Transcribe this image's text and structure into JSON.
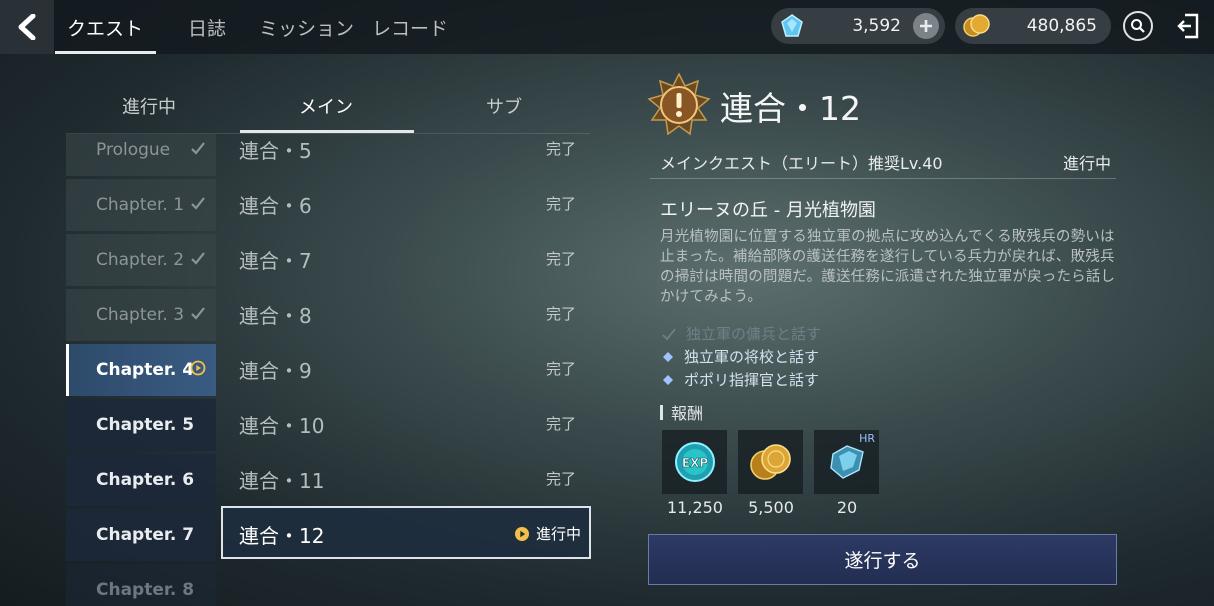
{
  "top_tabs": [
    "クエスト",
    "日誌",
    "ミッション",
    "レコード"
  ],
  "currency": {
    "gems": "3,592",
    "gold": "480,865"
  },
  "sub_tabs": [
    "進行中",
    "メイン",
    "サブ"
  ],
  "chapters": [
    {
      "label": "Prologue",
      "state": "done"
    },
    {
      "label": "Chapter. 1",
      "state": "done"
    },
    {
      "label": "Chapter. 2",
      "state": "done"
    },
    {
      "label": "Chapter. 3",
      "state": "done"
    },
    {
      "label": "Chapter. 4",
      "state": "current"
    },
    {
      "label": "Chapter. 5",
      "state": "todo"
    },
    {
      "label": "Chapter. 6",
      "state": "todo"
    },
    {
      "label": "Chapter. 7",
      "state": "todo"
    },
    {
      "label": "Chapter. 8",
      "state": "fade"
    }
  ],
  "quests": [
    {
      "name": "連合・5",
      "status": "完了"
    },
    {
      "name": "連合・6",
      "status": "完了"
    },
    {
      "name": "連合・7",
      "status": "完了"
    },
    {
      "name": "連合・8",
      "status": "完了"
    },
    {
      "name": "連合・9",
      "status": "完了"
    },
    {
      "name": "連合・10",
      "status": "完了"
    },
    {
      "name": "連合・11",
      "status": "完了"
    }
  ],
  "selected_quest": {
    "name": "連合・12",
    "status": "進行中"
  },
  "detail": {
    "title": "連合・12",
    "type": "メインクエスト（エリート）推奨Lv.40",
    "status": "進行中",
    "location": "エリーヌの丘 - 月光植物園",
    "description": "月光植物園に位置する独立軍の拠点に攻め込んでくる敗残兵の勢いは止まった。補給部隊の護送任務を遂行している兵力が戻れば、敗残兵の掃討は時間の問題だ。護送任務に派遣された独立軍が戻ったら話しかけてみよう。",
    "objectives": [
      {
        "text": "独立軍の傭兵と話す",
        "done": true
      },
      {
        "text": "独立軍の将校と話す",
        "done": false
      },
      {
        "text": "ポポリ指揮官と話す",
        "done": false
      }
    ],
    "reward_label": "報酬",
    "rewards": [
      {
        "icon": "exp-icon",
        "value": "11,250"
      },
      {
        "icon": "gold-coin-icon",
        "value": "5,500"
      },
      {
        "icon": "crystal-icon",
        "value": "20",
        "badge": "HR"
      }
    ],
    "action_label": "遂行する"
  }
}
